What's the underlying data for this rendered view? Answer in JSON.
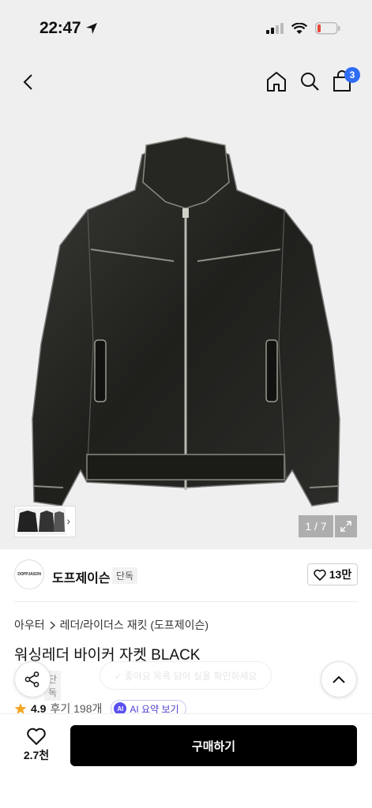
{
  "status_bar": {
    "time": "22:47"
  },
  "navbar": {
    "back_icon": "chevron-left-icon",
    "home_icon": "home-icon",
    "search_icon": "search-icon",
    "cart_icon": "shopping-bag-icon",
    "cart_count": "3",
    "badge_color": "#2f6cf6"
  },
  "gallery": {
    "pager": "1 / 7",
    "expand_icon": "expand-icon",
    "thumbnail_arrow": "›"
  },
  "brand": {
    "logo_text": "DOPPJASON",
    "name": "도프제이슨",
    "tag": "단독",
    "likes": "13만"
  },
  "product": {
    "breadcrumb": [
      "아우터",
      "레더/라이더스 재킷 (도프제이슨)"
    ],
    "title": "워싱레더 바이커 자켓 BLACK",
    "exclusive_tag": "단독",
    "rating": "4.9",
    "review_label": "후기 198개",
    "ai_badge": "AI",
    "ai_summary_label": "AI 요약 보기",
    "toast_text": "✓ 좋아요 목록 담아 실울 확인하세요"
  },
  "bottom_bar": {
    "wish_count": "2.7천",
    "buy_label": "구매하기"
  },
  "colors": {
    "accent": "#5a4ff0",
    "star": "#f5a623",
    "primary_button": "#000000"
  }
}
